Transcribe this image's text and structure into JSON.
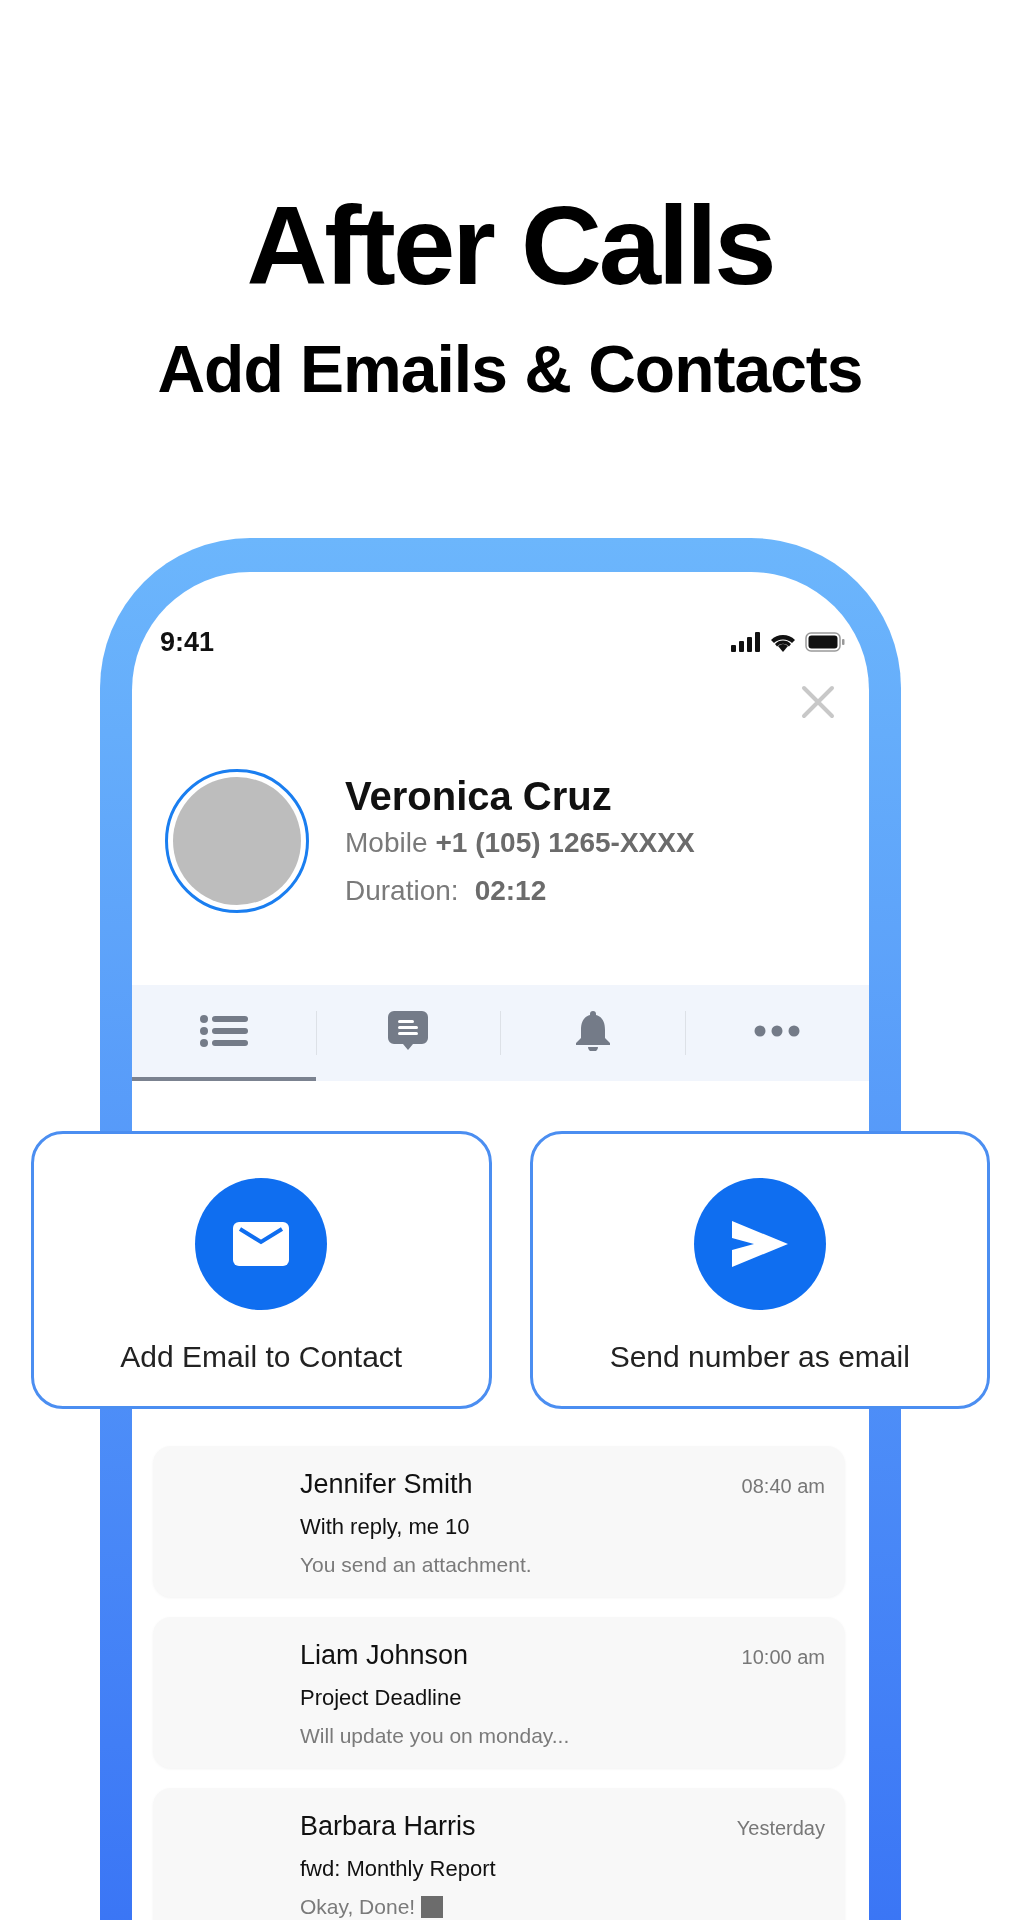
{
  "headline": "After Calls",
  "subheadline": "Add Emails & Contacts",
  "status_bar": {
    "time": "9:41"
  },
  "contact": {
    "name": "Veronica Cruz",
    "phone_label": "Mobile",
    "phone": "+1 (105) 1265-XXXX",
    "duration_label": "Duration:",
    "duration": "02:12"
  },
  "tabs": [
    {
      "selected": true
    },
    {
      "selected": false
    },
    {
      "selected": false
    },
    {
      "selected": false
    }
  ],
  "actions": [
    {
      "kind": "email",
      "label": "Add Email to Contact"
    },
    {
      "kind": "send",
      "label": "Send number as email"
    }
  ],
  "emails": [
    {
      "sender": "Jennifer Smith",
      "time": "08:40 am",
      "subject": "With reply, me 10",
      "preview": "You send an attachment."
    },
    {
      "sender": "Liam Johnson",
      "time": "10:00 am",
      "subject": "Project Deadline",
      "preview": "Will update you on monday..."
    },
    {
      "sender": "Barbara Harris",
      "time": "Yesterday",
      "subject": "fwd: Monthly Report",
      "preview": "Okay, Done!",
      "glyph": true
    }
  ]
}
